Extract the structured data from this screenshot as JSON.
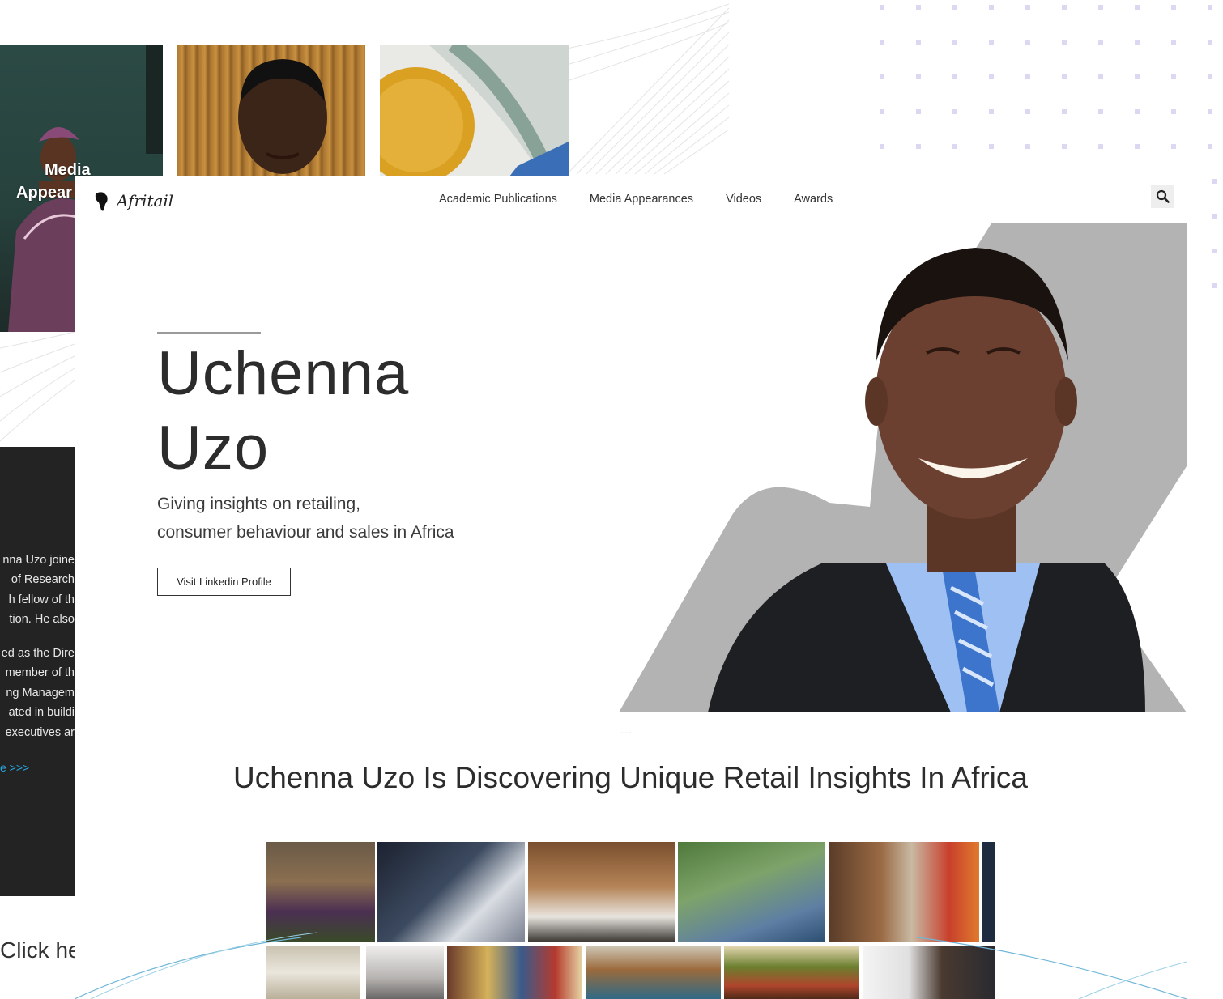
{
  "back_layer": {
    "media_tiles": [
      {
        "caption_lines": [
          "Media",
          "Appear"
        ]
      },
      {
        "caption_lines": []
      },
      {
        "caption_lines": []
      }
    ],
    "bio_lines": [
      "nna Uzo joine",
      "of Research",
      "h fellow of th",
      "tion. He also",
      "ed as the Dire",
      "member of th",
      "ng Managem",
      "ated in buildi",
      "executives ar"
    ],
    "bio_more": "e >>>",
    "click_here": "Click he"
  },
  "header": {
    "logo_text": "Afritail",
    "nav": [
      "Academic Publications",
      "Media Appearances",
      "Videos",
      "Awards"
    ],
    "search_icon": "search-icon"
  },
  "hero": {
    "name_line1": "Uchenna",
    "name_line2": "Uzo",
    "subtitle_line1": "Giving insights on retailing,",
    "subtitle_line2": "consumer behaviour and sales in Africa",
    "button_label": "Visit Linkedin Profile",
    "dots": "......"
  },
  "section": {
    "title": "Uchenna Uzo Is Discovering Unique Retail Insights In Africa"
  },
  "gallery": {
    "row1": [
      "market-vegetables-photo",
      "tablet-analytics-photo",
      "baker-mask-photo",
      "shopper-mask-photo",
      "textile-market-photo",
      "dark-edge-photo"
    ],
    "row2": [
      "masked-shopper-photo",
      "city-silhouette-photo",
      "kiosk-vendor-photo",
      "fruit-basket-photo",
      "produce-stall-photo",
      "office-meeting-photo"
    ]
  },
  "colors": {
    "accent_blue": "#27a9e1",
    "dark_panel": "#232323",
    "portrait_shape": "#b3b3b3",
    "dot_grid": "#ddd8f2"
  }
}
